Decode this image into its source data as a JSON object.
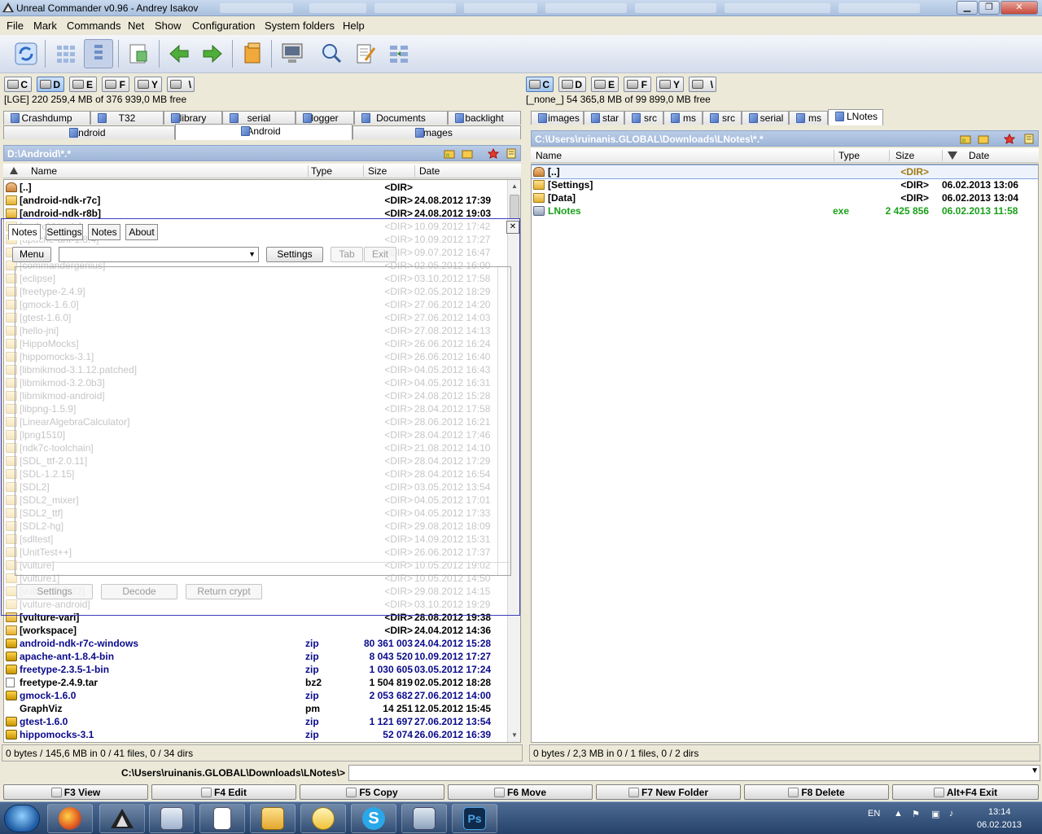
{
  "window": {
    "title": "Unreal Commander v0.96 - Andrey Isakov",
    "buttons": {
      "minimize": "▁",
      "maximize": "❐",
      "close": "✕"
    }
  },
  "menu": [
    "File",
    "Mark",
    "Commands",
    "Net",
    "Show",
    "Configuration",
    "System folders",
    "Help"
  ],
  "toolbar": {
    "icons": [
      "refresh-icon",
      "brief-view-icon",
      "full-view-icon",
      "sync-dirs-icon",
      "back-arrow-icon",
      "forward-arrow-icon",
      "copy-icon",
      "ftp-icon",
      "search-icon",
      "multi-rename-icon",
      "compare-icon"
    ]
  },
  "drives": {
    "left": [
      {
        "label": "C"
      },
      {
        "label": "D",
        "active": true
      },
      {
        "label": "E"
      },
      {
        "label": "F"
      },
      {
        "label": "Y"
      },
      {
        "label": "\\"
      }
    ],
    "right": [
      {
        "label": "C",
        "active": true
      },
      {
        "label": "D"
      },
      {
        "label": "E"
      },
      {
        "label": "F"
      },
      {
        "label": "Y"
      },
      {
        "label": "\\"
      }
    ]
  },
  "left": {
    "free_info": "[LGE]  220 259,4 MB of  376 939,0 MB free",
    "tabs_row1": [
      "Crashdump",
      "T32",
      "library",
      "serial",
      "logger",
      "Documents",
      "backlight"
    ],
    "tabs_row2": [
      "android",
      "Android",
      "images"
    ],
    "active_tab": "Android",
    "path": "D:\\Android\\*.*",
    "columns": [
      "Name",
      "Type",
      "Size",
      "Date"
    ],
    "files": [
      {
        "name": "[..]",
        "type": "",
        "size": "<DIR>",
        "date": "",
        "kind": "up"
      },
      {
        "name": "[android-ndk-r7c]",
        "type": "",
        "size": "<DIR>",
        "date": "24.08.2012 17:39",
        "kind": "folder"
      },
      {
        "name": "[android-ndk-r8b]",
        "type": "",
        "size": "<DIR>",
        "date": "24.08.2012 19:03",
        "kind": "folder"
      },
      {
        "name": "[android-tools]",
        "type": "",
        "size": "<DIR>",
        "date": "10.09.2012 17:42",
        "kind": "dim"
      },
      {
        "name": "[apache-ant-1.8.4]",
        "type": "",
        "size": "<DIR>",
        "date": "10.09.2012 17:27",
        "kind": "dim"
      },
      {
        "name": "[box2d]",
        "type": "",
        "size": "<DIR>",
        "date": "09.07.2012 16:47",
        "kind": "dim"
      },
      {
        "name": "[commandergenius]",
        "type": "",
        "size": "<DIR>",
        "date": "02.05.2012 16:00",
        "kind": "dim"
      },
      {
        "name": "[eclipse]",
        "type": "",
        "size": "<DIR>",
        "date": "03.10.2012 17:58",
        "kind": "dim"
      },
      {
        "name": "[freetype-2.4.9]",
        "type": "",
        "size": "<DIR>",
        "date": "02.05.2012 18:29",
        "kind": "dim"
      },
      {
        "name": "[gmock-1.6.0]",
        "type": "",
        "size": "<DIR>",
        "date": "27.06.2012 14:20",
        "kind": "dim"
      },
      {
        "name": "[gtest-1.6.0]",
        "type": "",
        "size": "<DIR>",
        "date": "27.06.2012 14:03",
        "kind": "dim"
      },
      {
        "name": "[hello-jni]",
        "type": "",
        "size": "<DIR>",
        "date": "27.08.2012 14:13",
        "kind": "dim"
      },
      {
        "name": "[HippoMocks]",
        "type": "",
        "size": "<DIR>",
        "date": "26.06.2012 16:24",
        "kind": "dim"
      },
      {
        "name": "[hippomocks-3.1]",
        "type": "",
        "size": "<DIR>",
        "date": "26.06.2012 16:40",
        "kind": "dim"
      },
      {
        "name": "[libmikmod-3.1.12.patched]",
        "type": "",
        "size": "<DIR>",
        "date": "04.05.2012 16:43",
        "kind": "dim"
      },
      {
        "name": "[libmikmod-3.2.0b3]",
        "type": "",
        "size": "<DIR>",
        "date": "04.05.2012 16:31",
        "kind": "dim"
      },
      {
        "name": "[libmikmod-android]",
        "type": "",
        "size": "<DIR>",
        "date": "24.08.2012 15:28",
        "kind": "dim"
      },
      {
        "name": "[libpng-1.5.9]",
        "type": "",
        "size": "<DIR>",
        "date": "28.04.2012 17:58",
        "kind": "dim"
      },
      {
        "name": "[LinearAlgebraCalculator]",
        "type": "",
        "size": "<DIR>",
        "date": "28.06.2012 16:21",
        "kind": "dim"
      },
      {
        "name": "[lpng1510]",
        "type": "",
        "size": "<DIR>",
        "date": "28.04.2012 17:46",
        "kind": "dim"
      },
      {
        "name": "[ndk7c-toolchain]",
        "type": "",
        "size": "<DIR>",
        "date": "21.08.2012 14:10",
        "kind": "dim"
      },
      {
        "name": "[SDL_ttf-2.0.11]",
        "type": "",
        "size": "<DIR>",
        "date": "28.04.2012 17:29",
        "kind": "dim"
      },
      {
        "name": "[SDL-1.2.15]",
        "type": "",
        "size": "<DIR>",
        "date": "28.04.2012 16:54",
        "kind": "dim"
      },
      {
        "name": "[SDL2]",
        "type": "",
        "size": "<DIR>",
        "date": "03.05.2012 13:54",
        "kind": "dim"
      },
      {
        "name": "[SDL2_mixer]",
        "type": "",
        "size": "<DIR>",
        "date": "04.05.2012 17:01",
        "kind": "dim"
      },
      {
        "name": "[SDL2_ttf]",
        "type": "",
        "size": "<DIR>",
        "date": "04.05.2012 17:33",
        "kind": "dim"
      },
      {
        "name": "[SDL2-hg]",
        "type": "",
        "size": "<DIR>",
        "date": "29.08.2012 18:09",
        "kind": "dim"
      },
      {
        "name": "[sdltest]",
        "type": "",
        "size": "<DIR>",
        "date": "14.09.2012 15:31",
        "kind": "dim"
      },
      {
        "name": "[UnitTest++]",
        "type": "",
        "size": "<DIR>",
        "date": "26.06.2012 17:37",
        "kind": "dim"
      },
      {
        "name": "[vulture]",
        "type": "",
        "size": "<DIR>",
        "date": "10.05.2012 19:02",
        "kind": "dim"
      },
      {
        "name": "[vulture1]",
        "type": "",
        "size": "<DIR>",
        "date": "10.05.2012 14:50",
        "kind": "dim"
      },
      {
        "name": "[vulture-2.3.22]",
        "type": "",
        "size": "<DIR>",
        "date": "29.08.2012 14:15",
        "kind": "dim"
      },
      {
        "name": "[vulture-android]",
        "type": "",
        "size": "<DIR>",
        "date": "03.10.2012 19:29",
        "kind": "dim"
      },
      {
        "name": "[vulture-vari]",
        "type": "",
        "size": "<DIR>",
        "date": "28.08.2012 19:38",
        "kind": "folder"
      },
      {
        "name": "[workspace]",
        "type": "",
        "size": "<DIR>",
        "date": "24.04.2012 14:36",
        "kind": "folder"
      },
      {
        "name": "android-ndk-r7c-windows",
        "type": "zip",
        "size": "80 361 003",
        "date": "24.04.2012 15:28",
        "kind": "arch"
      },
      {
        "name": "apache-ant-1.8.4-bin",
        "type": "zip",
        "size": "8 043 520",
        "date": "10.09.2012 17:27",
        "kind": "arch"
      },
      {
        "name": "freetype-2.3.5-1-bin",
        "type": "zip",
        "size": "1 030 605",
        "date": "03.05.2012 17:24",
        "kind": "arch"
      },
      {
        "name": "freetype-2.4.9.tar",
        "type": "bz2",
        "size": "1 504 819",
        "date": "02.05.2012 18:28",
        "kind": "file"
      },
      {
        "name": "gmock-1.6.0",
        "type": "zip",
        "size": "2 053 682",
        "date": "27.06.2012 14:00",
        "kind": "arch"
      },
      {
        "name": "GraphViz",
        "type": "pm",
        "size": "14 251",
        "date": "12.05.2012 15:45",
        "kind": "plain"
      },
      {
        "name": "gtest-1.6.0",
        "type": "zip",
        "size": "1 121 697",
        "date": "27.06.2012 13:54",
        "kind": "arch"
      },
      {
        "name": "hippomocks-3.1",
        "type": "zip",
        "size": "52 074",
        "date": "26.06.2012 16:39",
        "kind": "arch"
      }
    ],
    "status": "0 bytes / 145,6 MB in 0 / 41 files, 0 / 34 dirs"
  },
  "right": {
    "free_info": "[_none_]  54 365,8 MB of  99 899,0 MB free",
    "tabs": [
      "images",
      "star",
      "src",
      "ms",
      "src",
      "serial",
      "ms",
      "LNotes"
    ],
    "active_tab": "LNotes",
    "path": "C:\\Users\\ruinanis.GLOBAL\\Downloads\\LNotes\\*.*",
    "columns": [
      "Name",
      "Type",
      "Size",
      "Date"
    ],
    "files": [
      {
        "name": "[..]",
        "type": "",
        "size": "<DIR>",
        "date": "",
        "kind": "up"
      },
      {
        "name": "[Settings]",
        "type": "",
        "size": "<DIR>",
        "date": "06.02.2013 13:06",
        "kind": "folder"
      },
      {
        "name": "[Data]",
        "type": "",
        "size": "<DIR>",
        "date": "06.02.2013 13:04",
        "kind": "folder"
      },
      {
        "name": "LNotes",
        "type": "exe",
        "size": "2 425 856",
        "date": "06.02.2013 11:58",
        "kind": "exe"
      }
    ],
    "status": "0 bytes / 2,3 MB in 0 / 1 files, 0 / 2 dirs"
  },
  "cmdline": {
    "label": "C:\\Users\\ruinanis.GLOBAL\\Downloads\\LNotes\\>",
    "value": ""
  },
  "fkeys": [
    "F3 View",
    "F4 Edit",
    "F5 Copy",
    "F6 Move",
    "F7 New Folder",
    "F8 Delete",
    "Alt+F4 Exit"
  ],
  "dialog": {
    "tabs": [
      "Notes",
      "Settings",
      "Notes",
      "About"
    ],
    "menu_button": "Menu",
    "settings_button": "Settings",
    "tab_button": "Tab",
    "exit_button": "Exit",
    "bottom_buttons": [
      "Settings",
      "Decode",
      "Return crypt"
    ],
    "close": "✕"
  },
  "taskbar": {
    "apps": [
      "firefox-icon",
      "unreal-commander-icon",
      "calculator-icon",
      "notepad-icon",
      "explorer-icon",
      "outlook-icon",
      "skype-icon",
      "lnotes-icon",
      "photoshop-icon"
    ],
    "lang": "EN",
    "time": "13:14",
    "date": "06.02.2013"
  },
  "colors": {
    "accent": "#9fb6d8",
    "link_blue": "#0a0a8c",
    "exe_green": "#18a018",
    "dialog_border": "#3d3dbd"
  }
}
